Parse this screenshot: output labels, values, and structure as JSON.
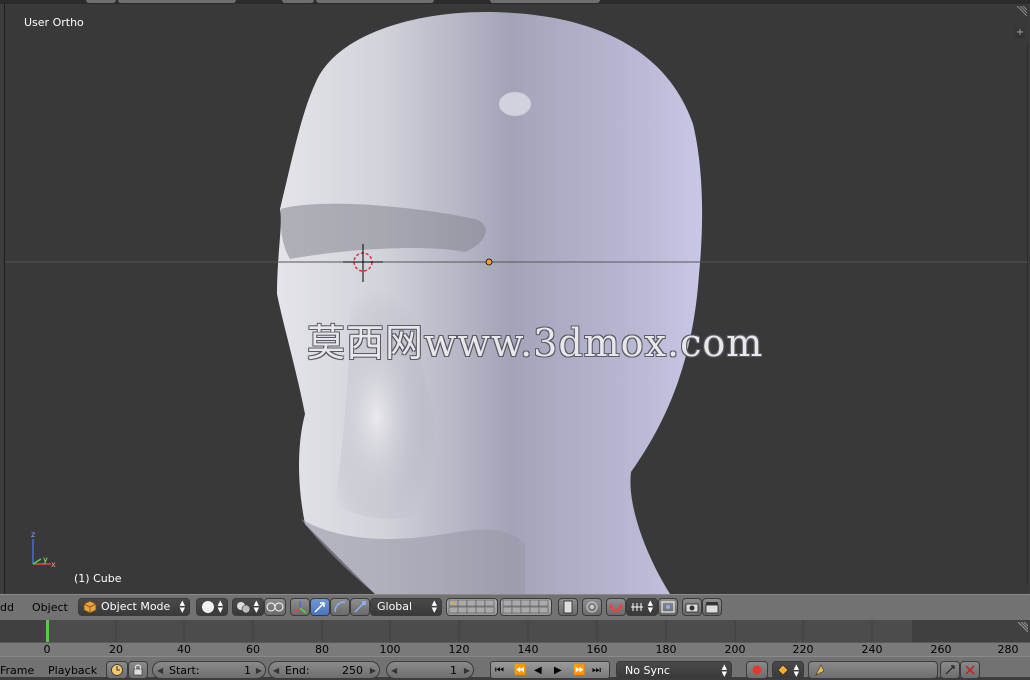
{
  "viewport": {
    "view_label": "User Ortho",
    "object_label": "(1) Cube",
    "watermark": "莫西网www.3dmox.com",
    "axis": {
      "z": "z",
      "x": "x",
      "y": "y"
    }
  },
  "header": {
    "menus": [
      "dd",
      "Object"
    ],
    "mode": "Object Mode",
    "orientation": "Global"
  },
  "timeline": {
    "current_frame": 1,
    "ticks": [
      "0",
      "20",
      "40",
      "60",
      "80",
      "100",
      "120",
      "140",
      "160",
      "180",
      "200",
      "220",
      "240",
      "260",
      "280"
    ]
  },
  "footer": {
    "menus": [
      "Frame",
      "Playback"
    ],
    "start_label": "Start:",
    "start_value": "1",
    "end_label": "End:",
    "end_value": "250",
    "frame_value": "1",
    "sync": "No Sync"
  },
  "colors": {
    "viewport_bg": "#393939",
    "header_bg": "#727272",
    "frame_marker": "#5ac84b",
    "active_button": "#5680c2"
  }
}
